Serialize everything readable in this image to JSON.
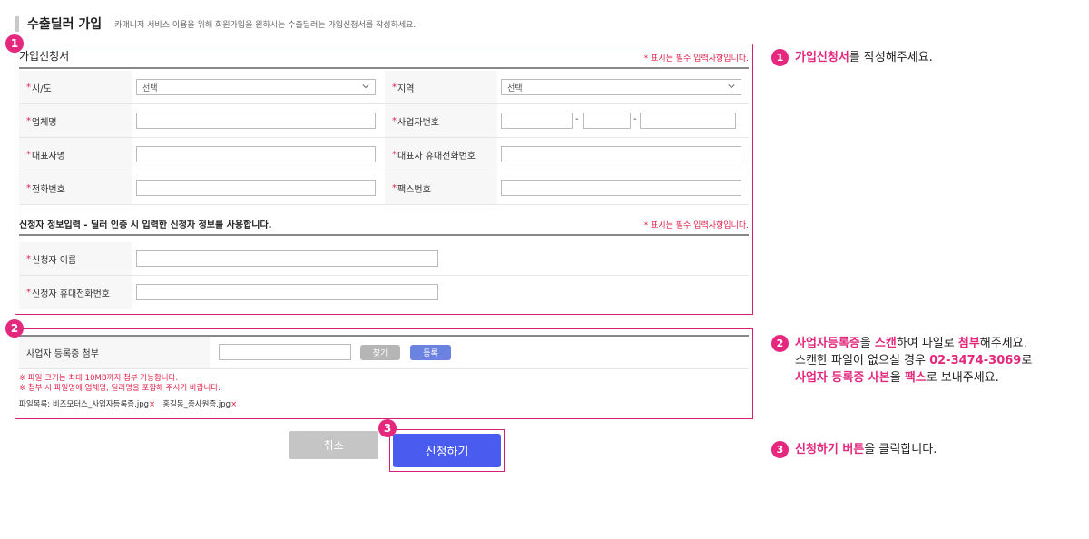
{
  "page": {
    "title": "수출딜러 가입",
    "description": "카매니저 서비스 이용을 위해 회원가입을 원하시는 수출딜러는 가입신청서를 작성하세요."
  },
  "markers": [
    "1",
    "2",
    "3"
  ],
  "section1": {
    "title": "가입신청서",
    "required_note": "* 표시는 필수 입력사항입니다.",
    "fields": {
      "sido_label": "시/도",
      "sido_value": "선택",
      "region_label": "지역",
      "region_value": "선택",
      "company_label": "업체명",
      "bizno_label": "사업자번호",
      "ceo_label": "대표자명",
      "ceo_mobile_label": "대표자 휴대전화번호",
      "phone_label": "전화번호",
      "fax_label": "팩스번호"
    },
    "applicant_heading": "신청자 정보입력 - 딜러 인증 시 입력한 신청자 정보를 사용합니다.",
    "applicant_required_note": "* 표시는 필수 입력사항입니다.",
    "applicant_name_label": "신청자 이름",
    "applicant_mobile_label": "신청자 휴대전화번호",
    "dash": "-"
  },
  "section2": {
    "label": "사업자 등록증 첨부",
    "find_button": "찾기",
    "register_button": "등록",
    "note1": "※ 파일 크기는 최대 10MB까지 첨부 가능합니다.",
    "note2": "※ 첨부 시 파일명에 업체명, 딜러명을 포함해 주시기 바랍니다.",
    "files_label": "파일목록:",
    "file1": "비즈모터스_사업자등록증.jpg",
    "file2": "홍길동_증사원증.jpg",
    "remove_mark": "×"
  },
  "buttons": {
    "cancel": "취소",
    "submit": "신청하기"
  },
  "guide": {
    "step1": {
      "num": "1",
      "hl": "가입신청서",
      "rest": "를 작성해주세요."
    },
    "step2": {
      "num": "2",
      "l1a": "사업자등록증",
      "l1b": "을 ",
      "l1c": "스캔",
      "l1d": "하여 파일로 ",
      "l1e": "첨부",
      "l1f": "해주세요.",
      "l2a": "스캔한 파일이 없으실 경우 ",
      "l2b": "02-3474-3069",
      "l2c": "로",
      "l3a": "사업자 등록증 사본",
      "l3b": "을 ",
      "l3c": "팩스",
      "l3d": "로 보내주세요."
    },
    "step3": {
      "num": "3",
      "hl": "신청하기 버튼",
      "rest": "을 클릭합니다."
    }
  },
  "colors": {
    "accent": "#e4287d",
    "border": "#d61f72",
    "submit": "#4a5cf0",
    "required": "#e0224a"
  }
}
